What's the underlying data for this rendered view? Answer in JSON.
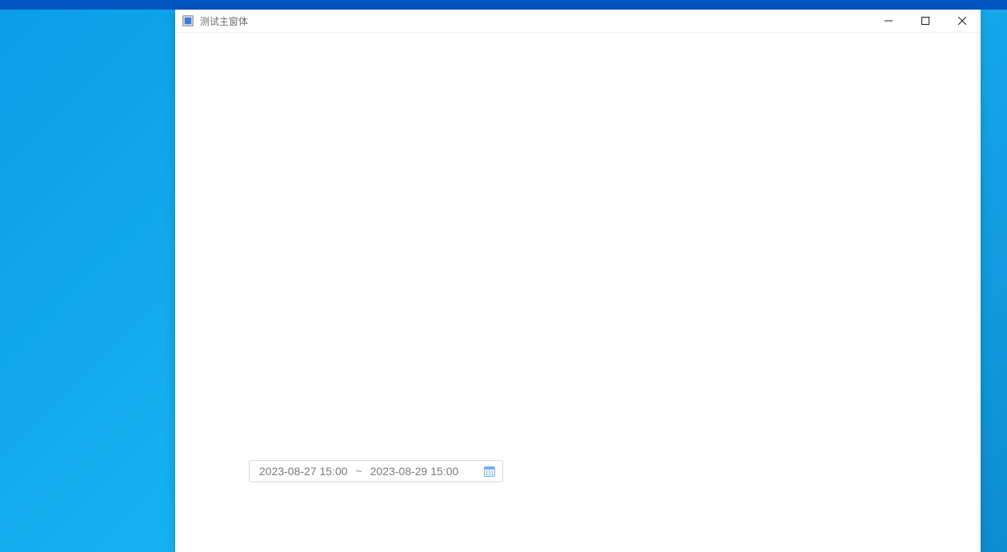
{
  "window": {
    "title": "测试主窗体"
  },
  "dateRange": {
    "start": "2023-08-27 15:00",
    "separator": "~",
    "end": "2023-08-29 15:00"
  }
}
